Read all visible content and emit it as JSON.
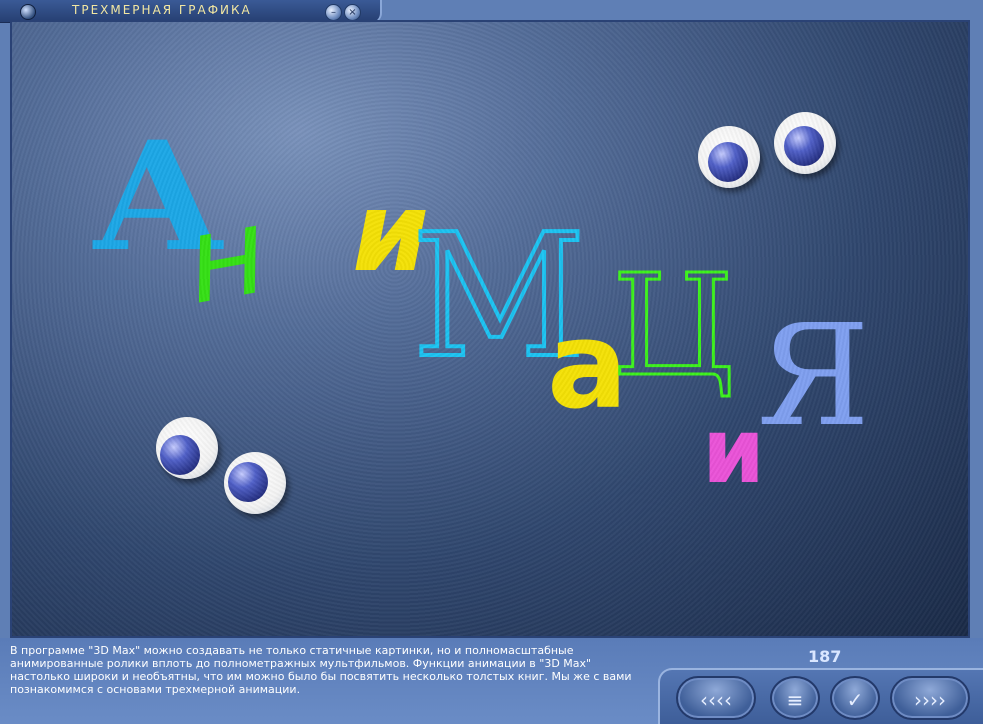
{
  "window": {
    "title": "ТРЕХМЕРНАЯ ГРАФИКА",
    "minimize_glyph": "–",
    "close_glyph": "×"
  },
  "animation_word": {
    "letters": [
      {
        "char": "А",
        "color": "#1ca7e6"
      },
      {
        "char": "н",
        "color": "#35e015"
      },
      {
        "char": "и",
        "color": "#f4e106"
      },
      {
        "char": "М",
        "color": "#1cc3f2"
      },
      {
        "char": "а",
        "color": "#f4e106"
      },
      {
        "char": "Ц",
        "color": "#3cf21c"
      },
      {
        "char": "и",
        "color": "#ea53d8"
      },
      {
        "char": "Я",
        "color": "#7f9ff0"
      }
    ]
  },
  "description": "В программе \"3D Max\" можно создавать не только статичные картинки, но и полномасштабные анимированные ролики вплоть до полнометражных мультфильмов. Функции анимации в \"3D Max\" настолько широки и необъятны, что им можно было бы посвятить несколько толстых книг. Мы же с вами познакомимся с основами трехмерной анимации.",
  "page_number": "187",
  "nav": {
    "back_glyph": "‹‹‹‹",
    "menu_glyph": "≡",
    "check_glyph": "✓",
    "forward_glyph": "››››"
  }
}
